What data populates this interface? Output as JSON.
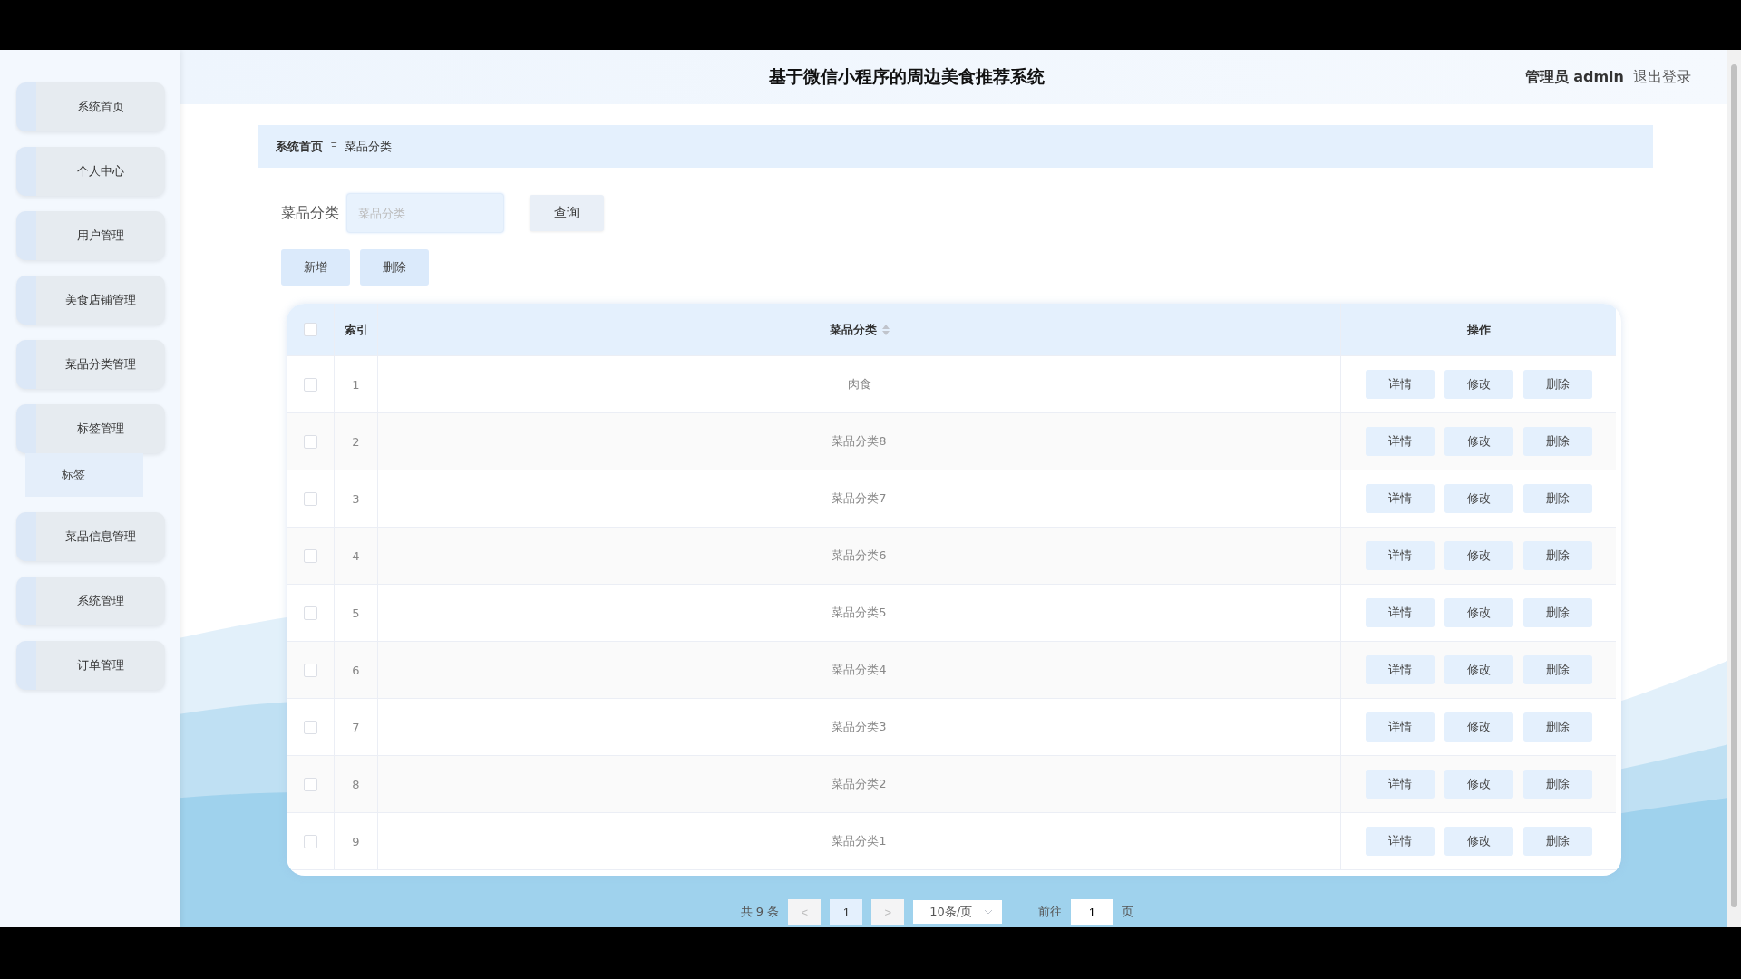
{
  "sidebar": {
    "items": [
      {
        "label": "系统首页"
      },
      {
        "label": "个人中心"
      },
      {
        "label": "用户管理"
      },
      {
        "label": "美食店铺管理"
      },
      {
        "label": "菜品分类管理"
      },
      {
        "label": "标签管理",
        "children": [
          {
            "label": "标签"
          }
        ]
      },
      {
        "label": "菜品信息管理"
      },
      {
        "label": "系统管理"
      },
      {
        "label": "订单管理"
      }
    ]
  },
  "header": {
    "title": "基于微信小程序的周边美食推荐系统",
    "user": "管理员 admin",
    "logout": "退出登录"
  },
  "breadcrumb": {
    "items": [
      "系统首页",
      "菜品分类"
    ],
    "separator": "Ξ"
  },
  "search": {
    "label": "菜品分类",
    "placeholder": "菜品分类",
    "button": "查询"
  },
  "actions": [
    "新增",
    "删除"
  ],
  "table": {
    "select_all": {
      "checked": false
    },
    "columns": [
      "索引",
      "菜品分类",
      "操作"
    ],
    "rows": [
      {
        "checked": false,
        "index": "1",
        "name": "肉食",
        "actions": [
          "详情",
          "修改",
          "删除"
        ]
      },
      {
        "checked": false,
        "index": "2",
        "name": "菜品分类8",
        "actions": [
          "详情",
          "修改",
          "删除"
        ]
      },
      {
        "checked": false,
        "index": "3",
        "name": "菜品分类7",
        "actions": [
          "详情",
          "修改",
          "删除"
        ]
      },
      {
        "checked": false,
        "index": "4",
        "name": "菜品分类6",
        "actions": [
          "详情",
          "修改",
          "删除"
        ]
      },
      {
        "checked": false,
        "index": "5",
        "name": "菜品分类5",
        "actions": [
          "详情",
          "修改",
          "删除"
        ]
      },
      {
        "checked": false,
        "index": "6",
        "name": "菜品分类4",
        "actions": [
          "详情",
          "修改",
          "删除"
        ]
      },
      {
        "checked": false,
        "index": "7",
        "name": "菜品分类3",
        "actions": [
          "详情",
          "修改",
          "删除"
        ]
      },
      {
        "checked": false,
        "index": "8",
        "name": "菜品分类2",
        "actions": [
          "详情",
          "修改",
          "删除"
        ]
      },
      {
        "checked": false,
        "index": "9",
        "name": "菜品分类1",
        "actions": [
          "详情",
          "修改",
          "删除"
        ]
      }
    ]
  },
  "pagination": {
    "total": "共 9 条",
    "prev": "<",
    "pages": [
      {
        "label": "1",
        "selected": true
      }
    ],
    "next": ">",
    "page_size": "10条/页",
    "goto_label": "前往",
    "goto_value": "1",
    "goto_suffix": "页"
  }
}
